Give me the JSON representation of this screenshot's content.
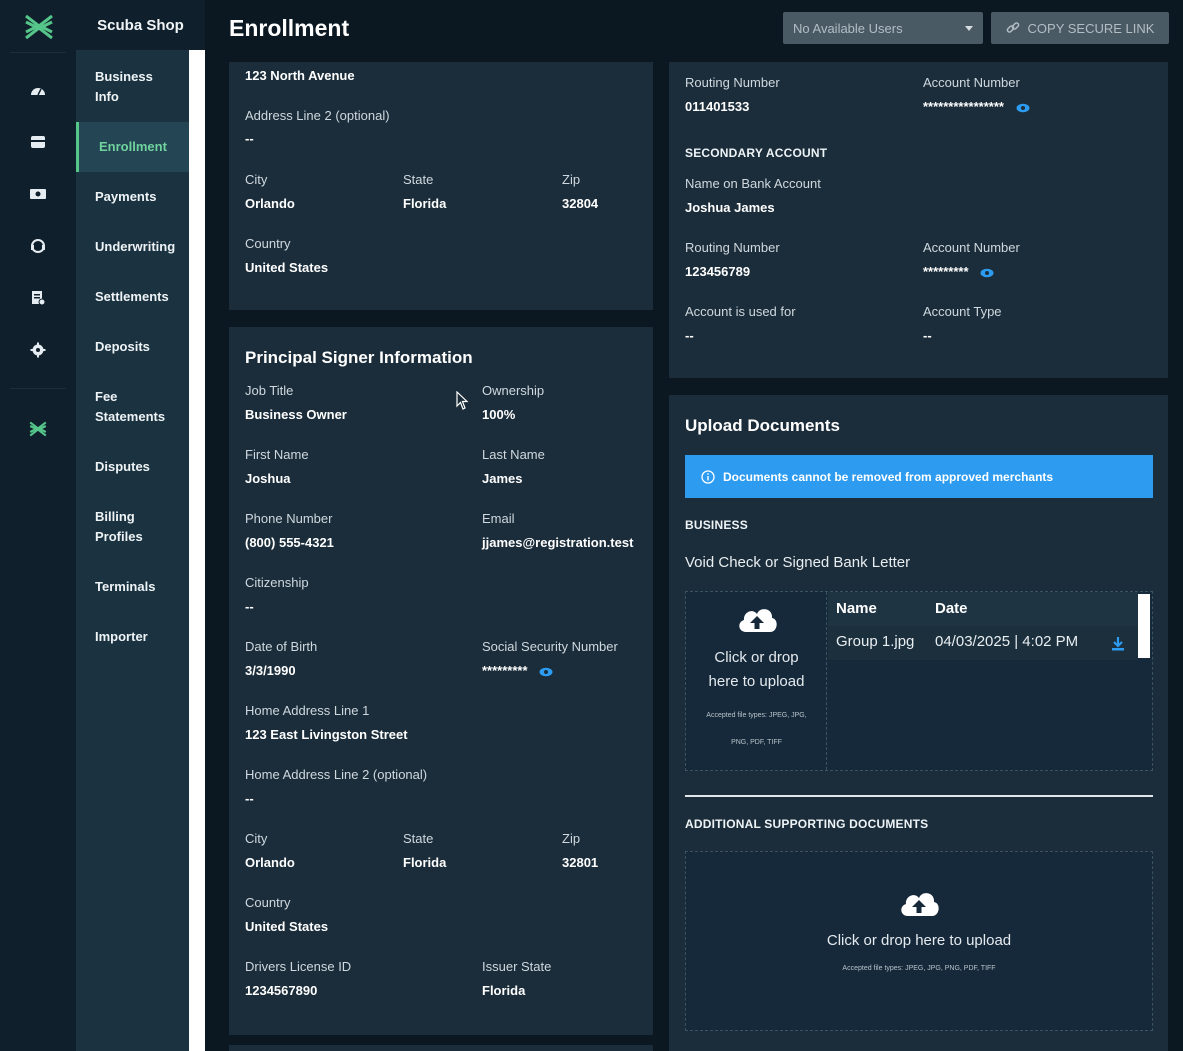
{
  "app": {
    "shop_name": "Scuba Shop",
    "page_title": "Enrollment",
    "brand_color": "#55c58a"
  },
  "icon_rail": [
    {
      "icon": "dashboard-gauge-icon"
    },
    {
      "icon": "store-icon"
    },
    {
      "icon": "cash-icon"
    },
    {
      "icon": "support-icon"
    },
    {
      "icon": "report-icon"
    },
    {
      "icon": "gear-icon"
    },
    {
      "icon": "brand-mark-icon"
    }
  ],
  "subnav": {
    "items": [
      {
        "label": "Business Info",
        "line1": "Business",
        "line2": "Info"
      },
      {
        "label": "Enrollment",
        "active": true
      },
      {
        "label": "Payments"
      },
      {
        "label": "Underwriting"
      },
      {
        "label": "Settlements"
      },
      {
        "label": "Deposits"
      },
      {
        "label": "Fee Statements",
        "line1": "Fee",
        "line2": "Statements"
      },
      {
        "label": "Disputes"
      },
      {
        "label": "Billing Profiles",
        "line1": "Billing",
        "line2": "Profiles"
      },
      {
        "label": "Terminals"
      },
      {
        "label": "Importer"
      }
    ]
  },
  "header": {
    "user_select_value": "No Available Users",
    "copy_link_label": "COPY SECURE LINK"
  },
  "address_card": {
    "address_line1_value": "123 North Avenue",
    "address_line2_label": "Address Line 2 (optional)",
    "address_line2_value": "--",
    "city_label": "City",
    "city_value": "Orlando",
    "state_label": "State",
    "state_value": "Florida",
    "zip_label": "Zip",
    "zip_value": "32804",
    "country_label": "Country",
    "country_value": "United States"
  },
  "principal": {
    "title": "Principal Signer Information",
    "job_title_label": "Job Title",
    "job_title_value": "Business Owner",
    "ownership_label": "Ownership",
    "ownership_value": "100%",
    "first_name_label": "First Name",
    "first_name_value": "Joshua",
    "last_name_label": "Last Name",
    "last_name_value": "James",
    "phone_label": "Phone Number",
    "phone_value": "(800) 555-4321",
    "email_label": "Email",
    "email_value": "jjames@registration.test",
    "citizenship_label": "Citizenship",
    "citizenship_value": "--",
    "dob_label": "Date of Birth",
    "dob_value": "3/3/1990",
    "ssn_label": "Social Security Number",
    "ssn_value": "*********",
    "home1_label": "Home Address Line 1",
    "home1_value": "123 East Livingston Street",
    "home2_label": "Home Address Line 2 (optional)",
    "home2_value": "--",
    "city_label": "City",
    "city_value": "Orlando",
    "state_label": "State",
    "state_value": "Florida",
    "zip_label": "Zip",
    "zip_value": "32801",
    "country_label": "Country",
    "country_value": "United States",
    "dl_label": "Drivers License ID",
    "dl_value": "1234567890",
    "issuer_label": "Issuer State",
    "issuer_value": "Florida"
  },
  "bank": {
    "primary_routing_label": "Routing Number",
    "primary_routing_value": "011401533",
    "primary_account_label": "Account Number",
    "primary_account_value": "****************",
    "secondary_title": "SECONDARY ACCOUNT",
    "name_label": "Name on Bank Account",
    "name_value": "Joshua James",
    "routing_label": "Routing Number",
    "routing_value": "123456789",
    "account_label": "Account Number",
    "account_value": "*********",
    "used_for_label": "Account is used for",
    "used_for_value": "--",
    "type_label": "Account Type",
    "type_value": "--"
  },
  "uploads": {
    "title": "Upload Documents",
    "banner": "Documents cannot be removed from approved merchants",
    "business_label": "BUSINESS",
    "doc_label": "Void Check or Signed Bank Letter",
    "drop_line1": "Click or drop",
    "drop_line2": "here to upload",
    "accepted_line1": "Accepted file types: JPEG, JPG,",
    "accepted_line2": "PNG, PDF, TIFF",
    "col_name": "Name",
    "col_date": "Date",
    "file_name": "Group 1.jpg",
    "file_date": "04/03/2025 | 4:02 PM",
    "additional_label": "ADDITIONAL SUPPORTING DOCUMENTS",
    "drop2": "Click or drop here to upload",
    "accepted2": "Accepted file types: JPEG, JPG, PNG, PDF, TIFF"
  },
  "colors": {
    "info_blue": "#2d9bf0",
    "eye_blue": "#2d9bf0"
  }
}
